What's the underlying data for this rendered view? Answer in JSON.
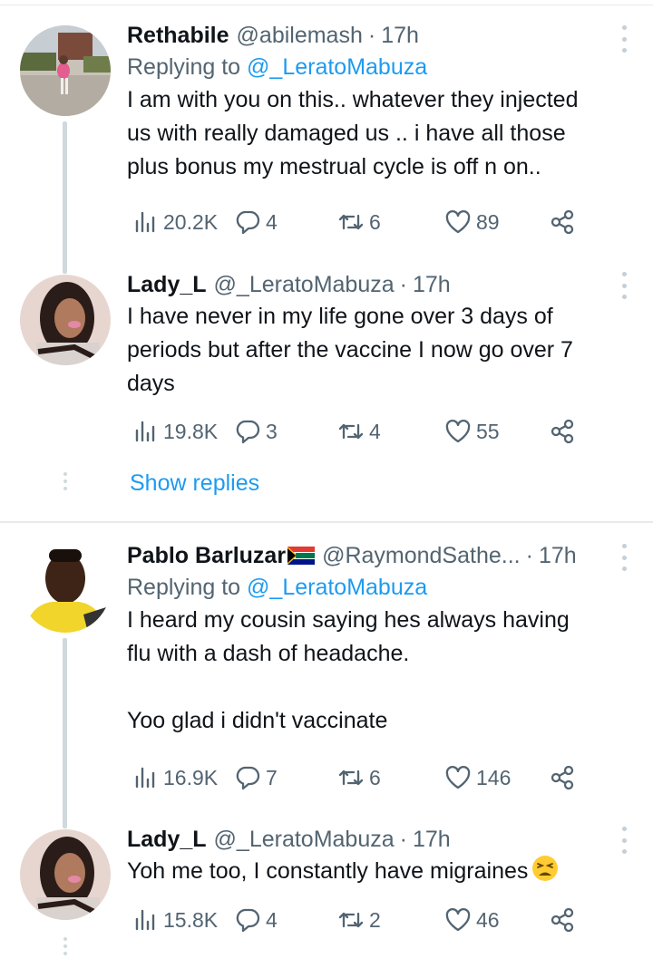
{
  "tweets": [
    {
      "name": "Rethabile",
      "handle": "@abilemash",
      "separator": "·",
      "time": "17h",
      "replying_label": "Replying to",
      "replying_to": "@_LeratoMabuza",
      "text": "I am with you on this.. whatever they injected\nus with really damaged us ..  i have all those\nplus bonus my mestrual cycle is off n on..",
      "stats": {
        "views": "20.2K",
        "replies": "4",
        "retweets": "6",
        "likes": "89"
      }
    },
    {
      "name": "Lady_L",
      "handle": "@_LeratoMabuza",
      "separator": "·",
      "time": "17h",
      "text": "I have never in my life gone over 3 days of\nperiods but after the vaccine I now go over 7\ndays",
      "stats": {
        "views": "19.8K",
        "replies": "3",
        "retweets": "4",
        "likes": "55"
      }
    },
    {
      "name": "Pablo Barluzar",
      "flag": "south-africa-flag",
      "handle": "@RaymondSathe...",
      "separator": "·",
      "time": "17h",
      "replying_label": "Replying to",
      "replying_to": "@_LeratoMabuza",
      "text": "I heard my cousin saying hes always having\nflu with a dash of headache.\n\nYoo glad i didn't vaccinate",
      "stats": {
        "views": "16.9K",
        "replies": "7",
        "retweets": "6",
        "likes": "146"
      }
    },
    {
      "name": "Lady_L",
      "handle": "@_LeratoMabuza",
      "separator": "·",
      "time": "17h",
      "text": "Yoh me too, I constantly have migraines",
      "emoji": "tired-face-emoji",
      "stats": {
        "views": "15.8K",
        "replies": "4",
        "retweets": "2",
        "likes": "46"
      }
    }
  ],
  "show_replies_label": "Show replies",
  "colors": {
    "link": "#1d9bf0",
    "secondary_text": "#536471",
    "thread_line": "#cfd9de"
  }
}
